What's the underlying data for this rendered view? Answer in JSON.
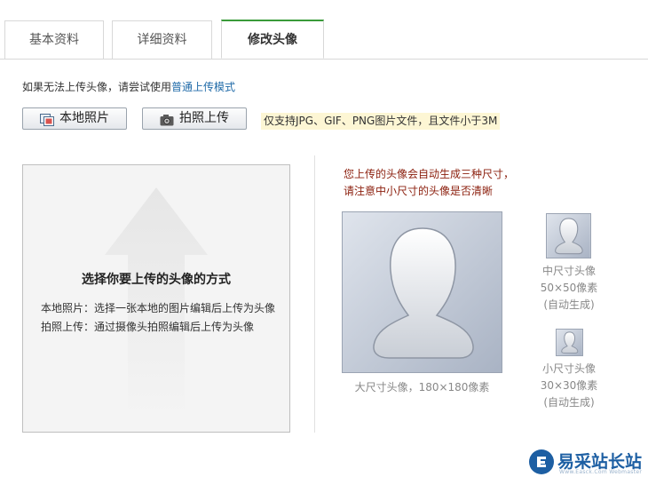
{
  "tabs": [
    {
      "label": "基本资料",
      "active": false
    },
    {
      "label": "详细资料",
      "active": false
    },
    {
      "label": "修改头像",
      "active": true
    }
  ],
  "notice": {
    "text": "如果无法上传头像，请尝试使用",
    "link": "普通上传模式"
  },
  "buttons": {
    "local_photo": "本地照片",
    "camera_upload": "拍照上传"
  },
  "tip": "仅支持JPG、GIF、PNG图片文件，且文件小于3M",
  "upload": {
    "title": "选择你要上传的头像的方式",
    "line1": "本地照片：选择一张本地的图片编辑后上传为头像",
    "line2": "拍照上传：通过摄像头拍照编辑后上传为头像"
  },
  "note": {
    "line1": "您上传的头像会自动生成三种尺寸，",
    "line2": "请注意中小尺寸的头像是否清晰"
  },
  "sizes": {
    "large": "大尺寸头像，180×180像素",
    "medium": [
      "中尺寸头像",
      "50×50像素",
      "(自动生成)"
    ],
    "small": [
      "小尺寸头像",
      "30×30像素",
      "(自动生成)"
    ]
  },
  "watermark": {
    "brand": "易采站长站",
    "sub": "Www.Easck.Com  Webmaster"
  },
  "colors": {
    "active_tab_accent": "#3a9b3a",
    "link": "#1f6aa8",
    "note": "#8b1e0c",
    "tip_bg": "#fdf6d4"
  }
}
